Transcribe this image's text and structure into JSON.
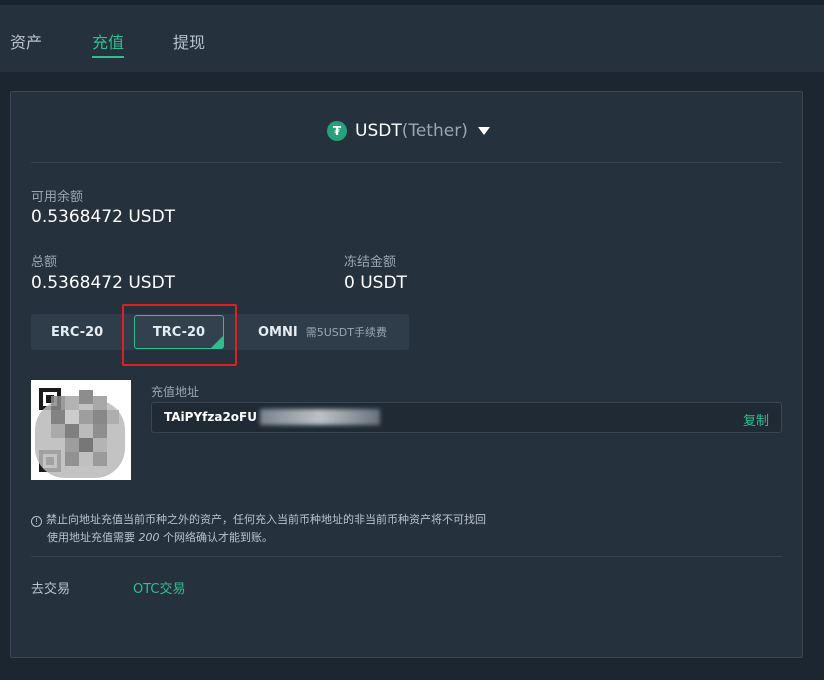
{
  "tabs": [
    {
      "label": "资产",
      "active": false
    },
    {
      "label": "充值",
      "active": true
    },
    {
      "label": "提现",
      "active": false
    }
  ],
  "coin": {
    "symbol": "USDT",
    "full_name": "(Tether)",
    "icon": "tether-icon",
    "icon_color": "#26a17b"
  },
  "balances": {
    "available_label": "可用余额",
    "available_value": "0.5368472 USDT",
    "total_label": "总额",
    "total_value": "0.5368472 USDT",
    "frozen_label": "冻结金额",
    "frozen_value": "0 USDT"
  },
  "chains": [
    {
      "label": "ERC-20",
      "active": false
    },
    {
      "label": "TRC-20",
      "active": true
    },
    {
      "label": "OMNI",
      "note": "需5USDT手续费",
      "active": false
    }
  ],
  "deposit": {
    "address_label": "充值地址",
    "address_visible": "TAiPYfza2oFU",
    "copy_label": "复制"
  },
  "notices": {
    "line1": "禁止向地址充值当前币种之外的资产，任何充入当前币种地址的非当前币种资产将不可找回",
    "line2_prefix": "使用地址充值需要",
    "line2_count": "200",
    "line2_suffix": "个网络确认才能到账。"
  },
  "footer": {
    "label": "去交易",
    "link": "OTC交易"
  },
  "colors": {
    "accent": "#2fbf8e",
    "highlight": "#e02020"
  }
}
